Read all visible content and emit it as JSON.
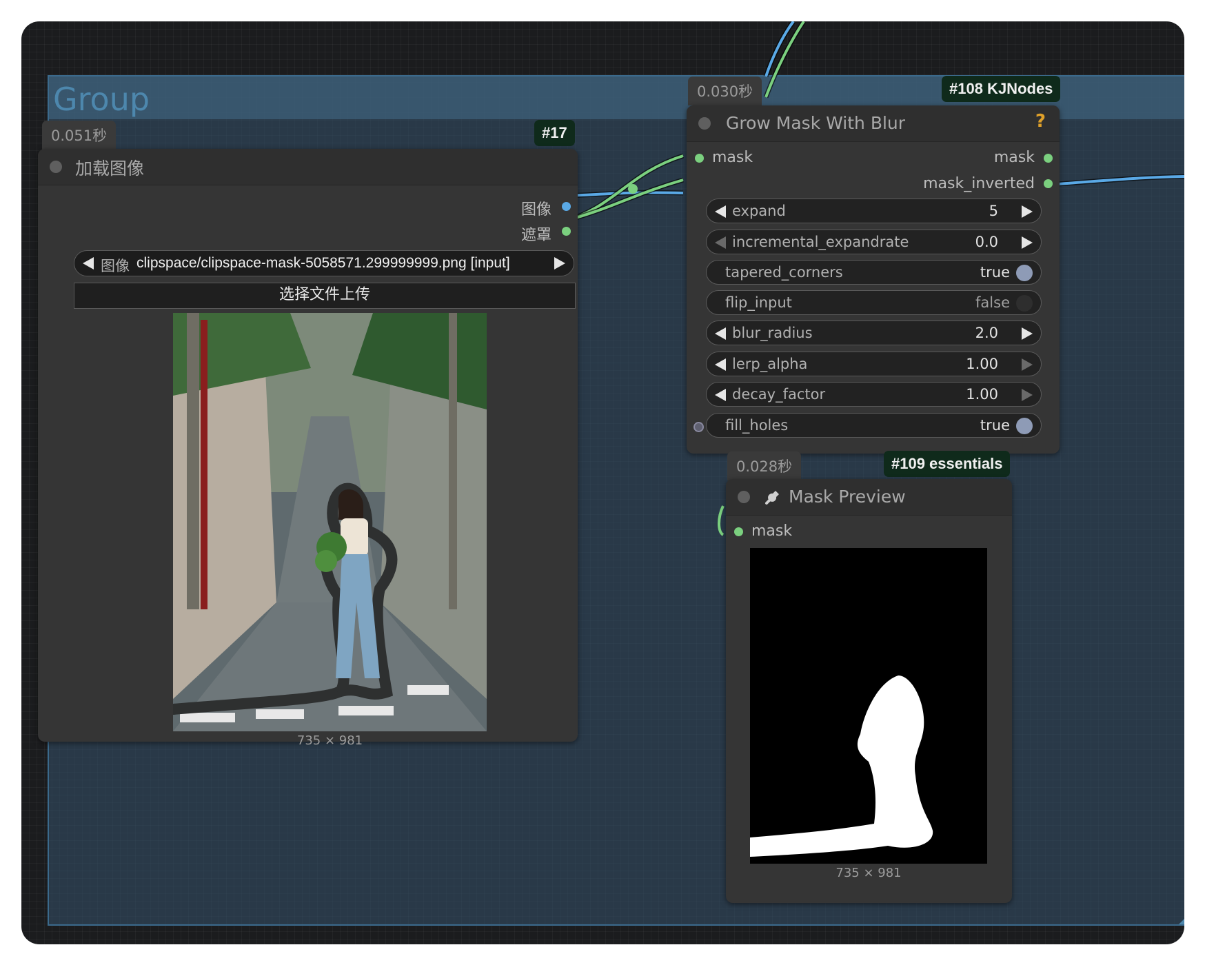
{
  "group": {
    "title": "Group"
  },
  "node17": {
    "time": "0.051秒",
    "id": "#17",
    "title": "加载图像",
    "outputs": [
      "图像",
      "遮罩"
    ],
    "image_widget": {
      "name": "图像",
      "value": "clipspace/clipspace-mask-5058571.299999999.png [input]"
    },
    "upload_label": "选择文件上传",
    "image_size": "735 × 981"
  },
  "node108": {
    "time": "0.030秒",
    "id": "#108 KJNodes",
    "title": "Grow Mask With Blur",
    "help_icon": "?",
    "input": "mask",
    "outputs": [
      "mask",
      "mask_inverted"
    ],
    "widgets": [
      {
        "name": "expand",
        "value": "5"
      },
      {
        "name": "incremental_expandrate",
        "value": "0.0"
      },
      {
        "name": "tapered_corners",
        "value": "true"
      },
      {
        "name": "flip_input",
        "value": "false"
      },
      {
        "name": "blur_radius",
        "value": "2.0"
      },
      {
        "name": "lerp_alpha",
        "value": "1.00"
      },
      {
        "name": "decay_factor",
        "value": "1.00"
      },
      {
        "name": "fill_holes",
        "value": "true"
      }
    ]
  },
  "node109": {
    "time": "0.028秒",
    "id": "#109 essentials",
    "title": "Mask Preview",
    "input": "mask",
    "image_size": "735 × 981"
  },
  "colors": {
    "mask_link": "#7bd07f",
    "image_link": "#5aa9e6",
    "group_border": "#3b6a8c",
    "help": "#e0a12a"
  },
  "icons": [
    "wrench-icon",
    "help-icon",
    "arrow-left-icon",
    "arrow-right-icon"
  ]
}
